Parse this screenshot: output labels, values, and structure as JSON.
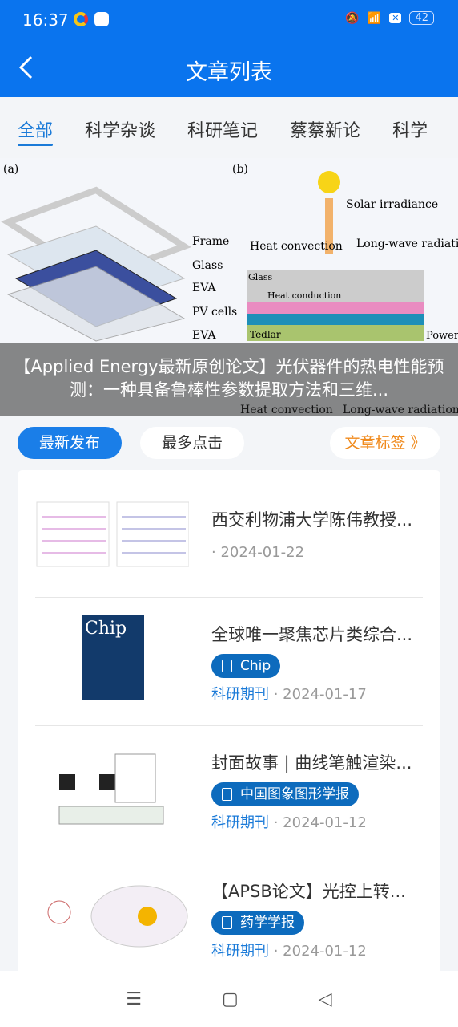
{
  "status": {
    "time": "16:37",
    "battery": "42"
  },
  "nav": {
    "title": "文章列表"
  },
  "tabs": [
    {
      "label": "全部",
      "active": true
    },
    {
      "label": "科学杂谈"
    },
    {
      "label": "科研笔记"
    },
    {
      "label": "蔡蔡新论"
    },
    {
      "label": "科学"
    }
  ],
  "banner": {
    "caption": "【Applied Energy最新原创论文】光伏器件的热电性能预测：一种具备鲁棒性参数提取方法和三维...",
    "figure_labels": {
      "a": "(a)",
      "b": "(b)",
      "frame": "Frame",
      "glass": "Glass",
      "eva": "EVA",
      "pv": "PV cells",
      "eva2": "EVA",
      "solar": "Solar irradiance",
      "hconv": "Heat convection",
      "lwr": "Long-wave radiation",
      "glass2": "Glass",
      "hcond": "Heat conduction",
      "tedlar": "Tedlar",
      "power": "Power",
      "hconv2": "Heat convection",
      "lwr2": "Long-wave radiation"
    }
  },
  "filters": {
    "latest": "最新发布",
    "most_clicked": "最多点击",
    "tags": "文章标签 》"
  },
  "articles": [
    {
      "title": "西交利物浦大学陈伟教授...",
      "source": "",
      "date": "· 2024-01-22"
    },
    {
      "title": "全球唯一聚焦芯片类综合...",
      "tag": "Chip",
      "source": "科研期刊",
      "date": " · 2024-01-17",
      "cover": "Chip"
    },
    {
      "title": "封面故事 | 曲线笔触渲染...",
      "tag": "中国图象图形学报",
      "source": "科研期刊",
      "date": " · 2024-01-12"
    },
    {
      "title": "【APSB论文】光控上转...",
      "tag": "药学学报",
      "source": "科研期刊",
      "date": " · 2024-01-12"
    }
  ],
  "colors": {
    "primary": "#0a74ee",
    "tag": "#0d6bbd",
    "accent": "#f08a1c"
  }
}
